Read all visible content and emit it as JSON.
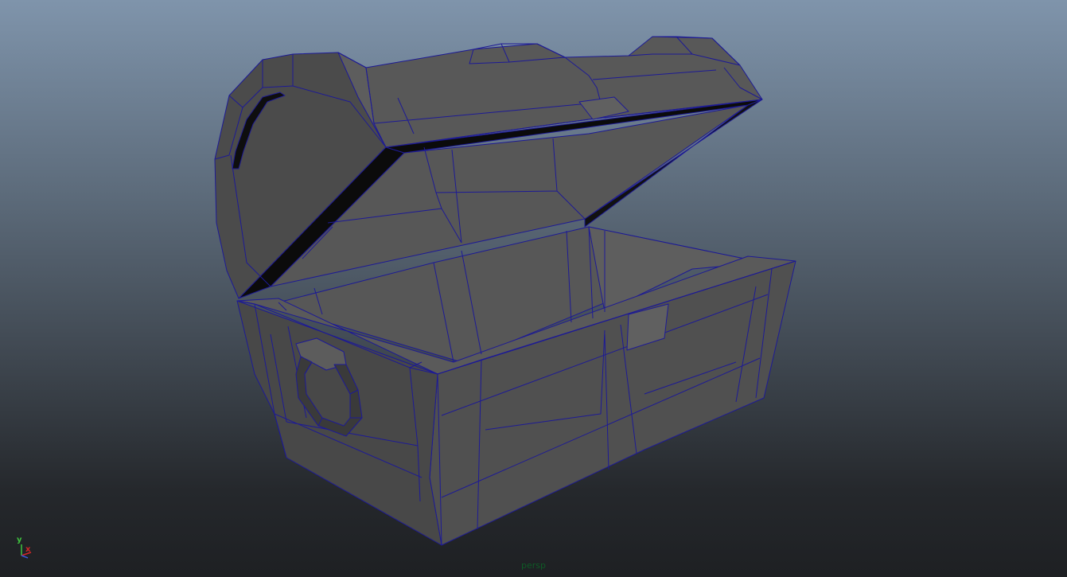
{
  "viewport": {
    "camera_name": "persp",
    "axes": {
      "x_label": "x",
      "y_label": "y"
    },
    "colors": {
      "wireframe": "#1d1a95",
      "face_light": "#5e5e5e",
      "face_mid": "#545454",
      "face_dark": "#444444",
      "face_shadow": "#0b0b0b",
      "camera_label": "#0e5a26",
      "axis_x": "#d32626",
      "axis_y": "#3fc23f",
      "axis_z": "#3a57d8"
    }
  }
}
